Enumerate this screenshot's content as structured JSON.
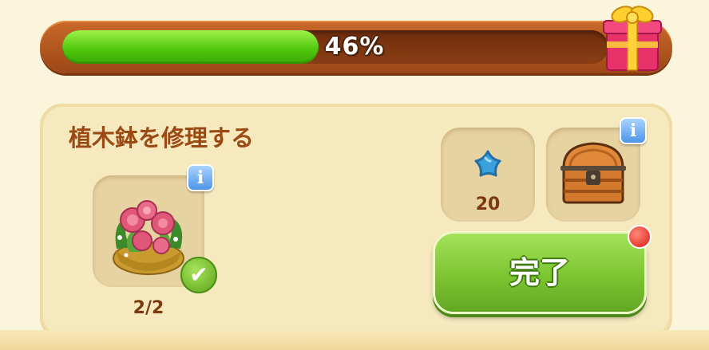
{
  "progress": {
    "percent_text": "46%",
    "fraction": 0.47,
    "reward_icon": "gift-box-icon"
  },
  "quest": {
    "title": "植木鉢を修理する",
    "task": {
      "icon": "flower-pot-icon",
      "count_text": "2/2",
      "completed_icon": "checkmark-icon",
      "info_label": "i"
    },
    "rewards": [
      {
        "icon": "blue-star-icon",
        "count_text": "20"
      },
      {
        "icon": "treasure-chest-icon",
        "info_label": "i"
      }
    ],
    "complete_label": "完了",
    "has_notification": true
  },
  "colors": {
    "progress_fill": "#52c80e",
    "frame": "#b5581f",
    "title": "#9a4a12",
    "complete_button": "#7cc531",
    "info_button": "#4d94e8",
    "notify": "#e01a10"
  }
}
